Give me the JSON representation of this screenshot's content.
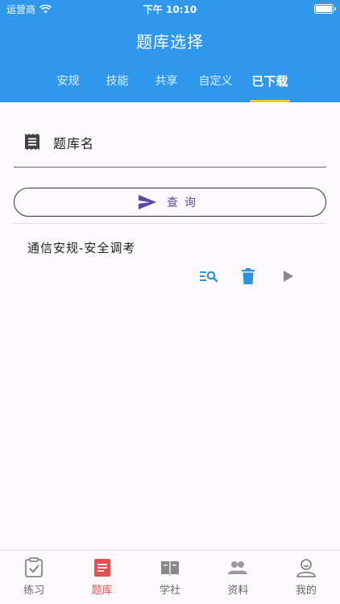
{
  "status_bar": {
    "carrier": "运营商",
    "time": "下午 10:10"
  },
  "header": {
    "title": "题库选择"
  },
  "tabs": [
    {
      "label": "安规",
      "active": false
    },
    {
      "label": "技能",
      "active": false
    },
    {
      "label": "共享",
      "active": false
    },
    {
      "label": "自定义",
      "active": false
    },
    {
      "label": "已下载",
      "active": true
    }
  ],
  "search": {
    "label": "题库名",
    "icon": "receipt-icon"
  },
  "query_button": {
    "label": "查询",
    "icon": "send-icon"
  },
  "bank_list": [
    {
      "title": "通信安规-安全调考",
      "actions": [
        "view-questions-icon",
        "delete-icon",
        "play-icon"
      ]
    }
  ],
  "bottom_nav": [
    {
      "label": "练习",
      "icon": "practice-icon",
      "active": false
    },
    {
      "label": "题库",
      "icon": "question-bank-icon",
      "active": true
    },
    {
      "label": "学社",
      "icon": "book-icon",
      "active": false
    },
    {
      "label": "资料",
      "icon": "people-icon",
      "active": false
    },
    {
      "label": "我的",
      "icon": "profile-icon",
      "active": false
    }
  ],
  "colors": {
    "header_bg": "#2f97ec",
    "tab_indicator": "#f5c43b",
    "accent_blue": "#2f8fe0",
    "button_text": "#5b4ba0",
    "nav_active": "#e35050"
  }
}
